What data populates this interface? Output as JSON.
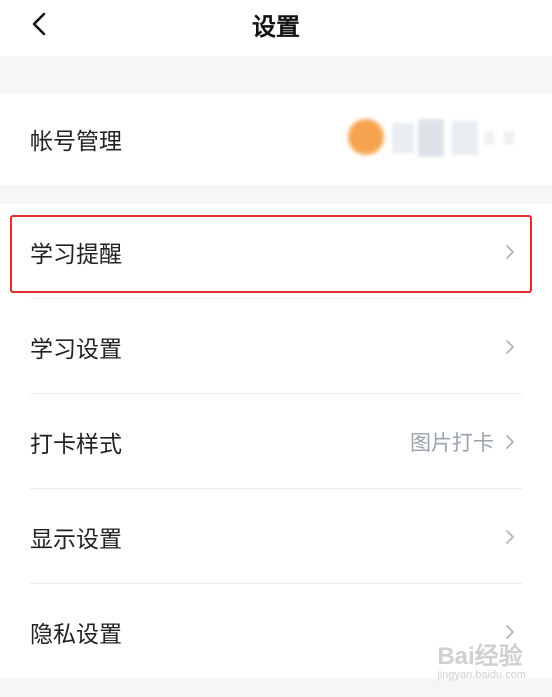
{
  "header": {
    "title": "设置",
    "back_icon": "chevron-left-icon"
  },
  "account": {
    "label": "帐号管理"
  },
  "settings": {
    "items": [
      {
        "label": "学习提醒",
        "value": ""
      },
      {
        "label": "学习设置",
        "value": ""
      },
      {
        "label": "打卡样式",
        "value": "图片打卡"
      },
      {
        "label": "显示设置",
        "value": ""
      },
      {
        "label": "隐私设置",
        "value": ""
      }
    ]
  },
  "highlight_color": "#e52b2b",
  "watermark": {
    "brand": "Bai经验",
    "url": "jingyan.baidu.com"
  }
}
